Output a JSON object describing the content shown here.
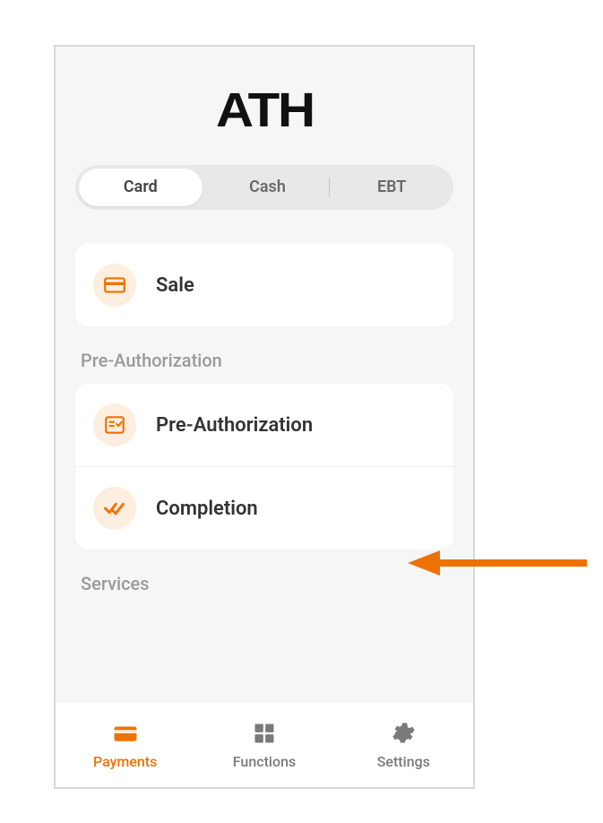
{
  "logo": "ATH",
  "tabs": {
    "card": "Card",
    "cash": "Cash",
    "ebt": "EBT",
    "active": "card"
  },
  "sale": {
    "label": "Sale"
  },
  "preauth": {
    "section": "Pre-Authorization",
    "preauth_label": "Pre-Authorization",
    "completion_label": "Completion"
  },
  "services": {
    "section": "Services"
  },
  "nav": {
    "payments": "Payments",
    "functions": "Functions",
    "settings": "Settings",
    "active": "payments"
  },
  "accent": "#ed7203"
}
